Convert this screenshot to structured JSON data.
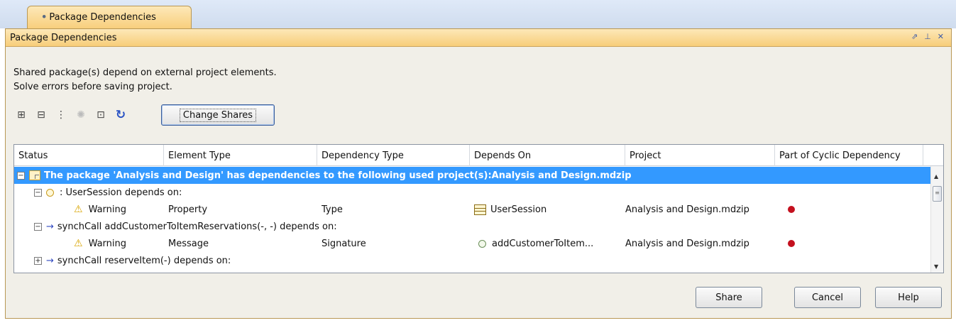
{
  "tab": {
    "label": "Package Dependencies"
  },
  "window": {
    "title": "Package Dependencies",
    "controls": [
      "restore-icon",
      "pin-icon",
      "close-icon"
    ]
  },
  "message": {
    "line1": "Shared package(s) depend on external project elements.",
    "line2": "Solve errors before saving project."
  },
  "toolbar": {
    "icons": [
      "expand-all-icon",
      "collapse-all-icon",
      "expand-icon",
      "lightbulb-icon",
      "select-in-tree-icon",
      "refresh-icon"
    ],
    "change_shares_label": "Change Shares"
  },
  "table": {
    "columns": [
      "Status",
      "Element Type",
      "Dependency Type",
      "Depends On",
      "Project",
      "Part of Cyclic Dependency"
    ],
    "group_row": "The package 'Analysis and Design' has dependencies to the following used project(s):Analysis and Design.mdzip",
    "rows": [
      {
        "label": ": UserSession depends on:"
      },
      {
        "status": "Warning",
        "element_type": "Property",
        "dependency_type": "Type",
        "depends_on": "UserSession",
        "project": "Analysis and Design.mdzip",
        "cyclic": true
      },
      {
        "label": "synchCall addCustomerToItemReservations(-, -) depends on:"
      },
      {
        "status": "Warning",
        "element_type": "Message",
        "dependency_type": "Signature",
        "depends_on": "addCustomerToItem...",
        "project": "Analysis and Design.mdzip",
        "cyclic": true
      },
      {
        "label": "synchCall reserveItem(-) depends on:"
      }
    ]
  },
  "buttons": {
    "share": "Share",
    "cancel": "Cancel",
    "help": "Help"
  },
  "colors": {
    "selection": "#3399ff",
    "header_gradient": "#fde8b8",
    "cyclic_dot": "#c4101e"
  }
}
